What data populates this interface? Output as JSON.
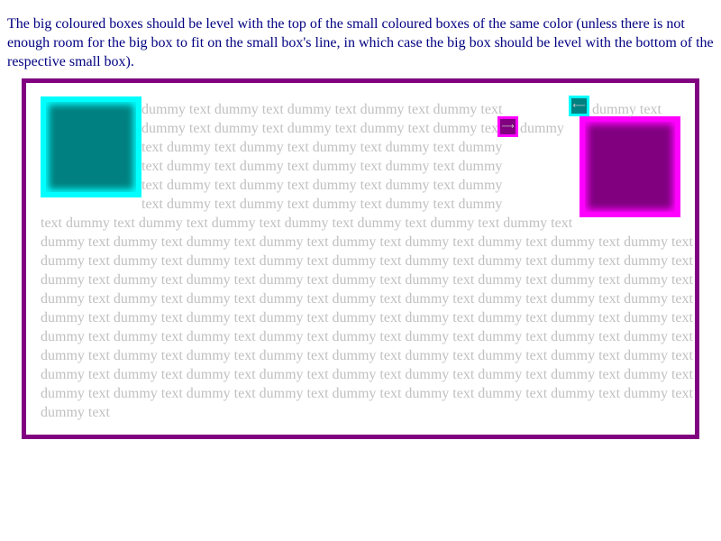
{
  "instructions": "The big coloured boxes should be level with the top of the small coloured boxes of the same color (unless there is not enough room for the big box to fit on the small box's line, in which case the big box should be level with the bottom of the respective small box).",
  "colors": {
    "container_border": "#800080",
    "text": "#c0c0c0",
    "instructions_text": "#000080",
    "cyan_border": "#00ffff",
    "cyan_fill": "#008080",
    "magenta_border": "#ff00ff",
    "magenta_fill": "#800080"
  },
  "small_cyan_arrow": "⟵",
  "small_magenta_arrow": "⟶",
  "lines": [
    "dummy text dummy text dummy text dummy text dummy text",
    "dummy text",
    "dummy text dummy text dummy text dummy text dummy text",
    "dummy",
    "text dummy text dummy text dummy text dummy text dummy",
    "text dummy text dummy text dummy text dummy text dummy",
    "text dummy text dummy text dummy text dummy text dummy",
    "text dummy text dummy text dummy text dummy text dummy",
    "text dummy text dummy text dummy text dummy text dummy text dummy text dummy text",
    "dummy text dummy text dummy text dummy text dummy text dummy text dummy text dummy text dummy text",
    "dummy text dummy text dummy text dummy text dummy text dummy text dummy text dummy text dummy text",
    "dummy text dummy text dummy text dummy text dummy text dummy text dummy text dummy text dummy text",
    "dummy text dummy text dummy text dummy text dummy text dummy text dummy text dummy text dummy text",
    "dummy text dummy text dummy text dummy text dummy text dummy text dummy text dummy text dummy text",
    "dummy text dummy text dummy text dummy text dummy text dummy text dummy text dummy text dummy text",
    "dummy text dummy text dummy text dummy text dummy text dummy text dummy text dummy text dummy text",
    "dummy text dummy text dummy text dummy text dummy text dummy text dummy text dummy text dummy text",
    "dummy text dummy text dummy text dummy text dummy text dummy text dummy text dummy text dummy text",
    "dummy text"
  ]
}
